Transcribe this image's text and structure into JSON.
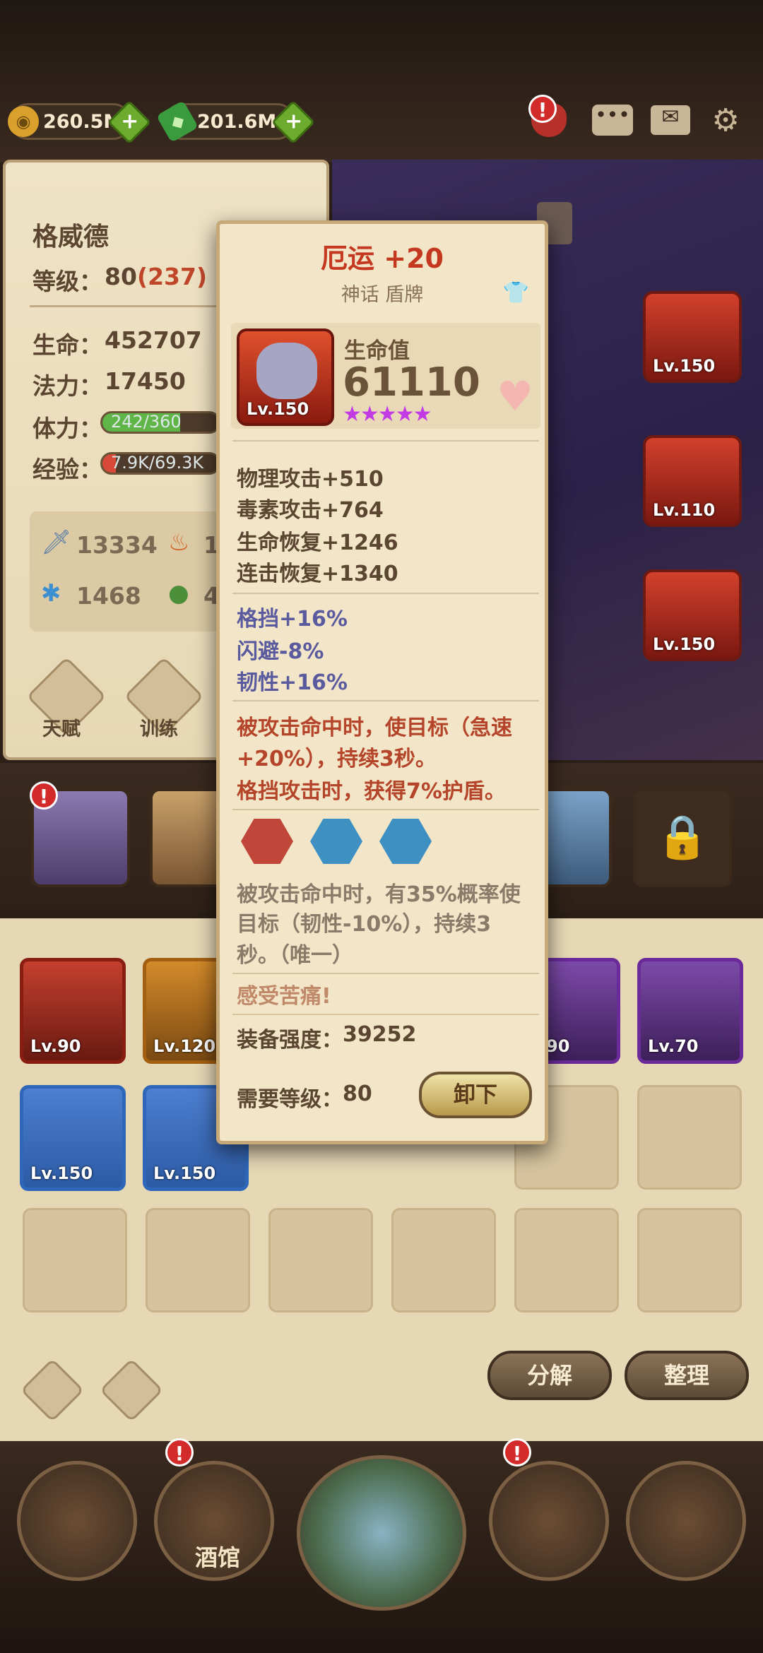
{
  "topbar": {
    "gold": "260.5M",
    "gems": "201.6M",
    "alert_badge": "!"
  },
  "hero": {
    "name": "格威德",
    "level_label": "等级：",
    "level": "80",
    "level_extra": "(237)",
    "hp_label": "生命：",
    "hp": "452707",
    "mp_label": "法力：",
    "mp": "17450",
    "stamina_label": "体力：",
    "stamina": "242/360",
    "stamina_ratio": 0.672,
    "exp_label": "经验：",
    "exp": "7.9K/69.3K",
    "exp_ratio": 0.114,
    "stat_attack": "13334",
    "stat_fire": "1",
    "stat_ice": "1468",
    "stat_poison": "4",
    "talent_label": "天赋",
    "train_label": "训练"
  },
  "slot_levels": [
    "Lv.150",
    "Lv.110",
    "Lv.150"
  ],
  "inventory": {
    "row1_levels": [
      "Lv.90",
      "Lv.120",
      "90",
      "Lv.70"
    ],
    "row2_levels": [
      "Lv.150",
      "Lv.150"
    ],
    "decompose": "分解",
    "sort": "整理"
  },
  "nav": {
    "tavern": "酒馆",
    "badge": "!"
  },
  "tooltip": {
    "title": "厄运 +20",
    "subtitle": "神话 盾牌",
    "item_level": "Lv.150",
    "main_stat_label": "生命值",
    "main_stat_value": "61110",
    "stars": "★★★★★",
    "stats": [
      "物理攻击+510",
      "毒素攻击+764",
      "生命恢复+1246",
      "连击恢复+1340"
    ],
    "bonus_stats": [
      "格挡+16%",
      "闪避-8%",
      "韧性+16%"
    ],
    "effect_line1": "被攻击命中时，使目标（急速",
    "effect_line2": "+20%），持续3秒。",
    "effect_line3": "格挡攻击时，获得7%护盾。",
    "set_line1": "被攻击命中时，有35%概率使",
    "set_line2": "目标（韧性-10%），持续3",
    "set_line3": "秒。（唯一）",
    "flavor": "感受苦痛!",
    "power_label": "装备强度：",
    "power_value": "39252",
    "req_label": "需要等级：",
    "req_value": "80",
    "unequip": "卸下",
    "colors": {
      "gem_red": "#c0463a",
      "gem_blue": "#3e8fc2",
      "stat_purple": "#5a5a9e",
      "effect_red": "#b5452a"
    }
  }
}
